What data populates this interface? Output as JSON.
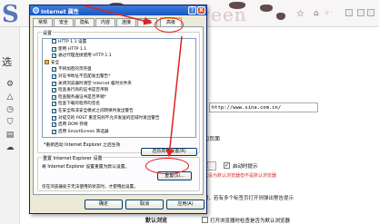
{
  "browser": {
    "logo_letter": "S",
    "tab_title_fragment": "ween",
    "bookmark_icon": "star-icon",
    "home_icon": "house-icon",
    "toolbar_more": "☆ ·",
    "sidebar_label": "选",
    "sidebar_icons": [
      "gear-icon",
      "triangle-icon",
      "clock-icon",
      "shield-icon",
      "document-icon",
      "cloud-icon"
    ],
    "homepage_url": "http://www.sina.com.cn/",
    "page_suffix": "的页面",
    "select_fragment": "就",
    "check_label": "启动时提示",
    "red_note": "已设为默认浏览器但不是默认浏览器",
    "tab_behavior_text": "时，若有多个标签页打开则弹出警告提示",
    "default_label": "默认浏览",
    "default_check_label": "打开浏览器时检查是否为默认浏览器"
  },
  "dialog": {
    "title": "Internet 属性",
    "help_label": "?",
    "close_label": "X",
    "tabs": [
      "常规",
      "安全",
      "隐私",
      "内容",
      "连接",
      "程序",
      "高级"
    ],
    "active_tab": "高级",
    "settings_heading": "设置",
    "settings_items": [
      {
        "kind": "option",
        "label": "HTTP 1.1 设置",
        "checked": false
      },
      {
        "kind": "option",
        "label": "使用 HTTP 1.1",
        "checked": true
      },
      {
        "kind": "option",
        "label": "通过代理连接使用 HTTP 1.1",
        "checked": true
      },
      {
        "kind": "category",
        "label": "安全"
      },
      {
        "kind": "option",
        "label": "不将加密的页存盘",
        "checked": true
      },
      {
        "kind": "option",
        "label": "对证书地址不匹配发出警告*",
        "checked": true
      },
      {
        "kind": "option",
        "label": "关闭浏览器时清空 Internet 临时文件夹",
        "checked": true
      },
      {
        "kind": "option",
        "label": "检查发行商的证书是否吊销",
        "checked": true
      },
      {
        "kind": "option",
        "label": "检查服务器证书是否吊销*",
        "checked": true
      },
      {
        "kind": "option",
        "label": "检查下载的程序的签名",
        "checked": true
      },
      {
        "kind": "option",
        "label": "在安全和非安全模式之间转换时发出警告",
        "checked": true
      },
      {
        "kind": "option",
        "label": "对提交的 POST 重定向到不允许发送的区域时发出警告",
        "checked": true
      },
      {
        "kind": "option",
        "label": "启用 DOM 存储",
        "checked": true
      },
      {
        "kind": "option",
        "label": "启用 SmartScreen 筛选器",
        "checked": true
      }
    ],
    "restart_note": "*重新启动 Internet Explorer 之后生效",
    "restore_advanced_label": "还原高级设置(R)",
    "reset_heading": "重置 Internet Explorer 设置",
    "reset_description": "将 Internet Explorer 设置重置为默认设置。",
    "reset_button_label": "重置(S)...",
    "reset_note": "仅在浏览器处于无法使用的状态时，才使用此设置。",
    "ok_label": "确定",
    "cancel_label": "取消",
    "apply_label": "应用(A)"
  },
  "annotation": {
    "color": "#e02222"
  }
}
